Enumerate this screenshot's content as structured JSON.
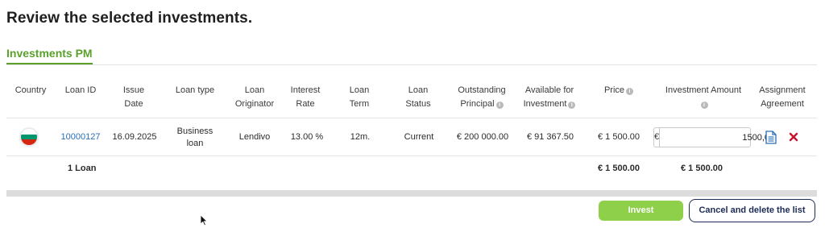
{
  "page": {
    "title": "Review the selected investments."
  },
  "tab": {
    "label": "Investments PM"
  },
  "table": {
    "headers": [
      "Country",
      "Loan ID",
      "Issue Date",
      "Loan type",
      "Loan Originator",
      "Interest Rate",
      "Loan Term",
      "Loan Status",
      "Outstanding Principal",
      "Available for Investment",
      "Price",
      "Investment Amount",
      "Assignment Agreement"
    ],
    "row": {
      "country_flag": "bulgaria-flag-icon",
      "loan_id": "10000127",
      "issue_date": "16.09.2025",
      "loan_type": "Business loan",
      "loan_originator": "Lendivo",
      "interest_rate": "13.00 %",
      "loan_term": "12m.",
      "loan_status": "Current",
      "outstanding_principal": "€ 200 000.00",
      "available_for_investment": "€ 91 367.50",
      "price": "€ 1 500.00",
      "currency_symbol": "€",
      "investment_amount": "1500,00",
      "agreement_icon": "document-icon",
      "remove_icon": "close-icon"
    },
    "totals": {
      "label": "1 Loan",
      "price": "€ 1 500.00",
      "investment_amount": "€ 1 500.00"
    }
  },
  "buttons": {
    "invest": "Invest",
    "cancel": "Cancel and delete the list"
  },
  "colors": {
    "accent_green": "#5aa02c",
    "invest_button": "#8fd04a",
    "link_blue": "#2a6fb5",
    "remove_red": "#c8102e",
    "navy": "#1d2b55"
  }
}
